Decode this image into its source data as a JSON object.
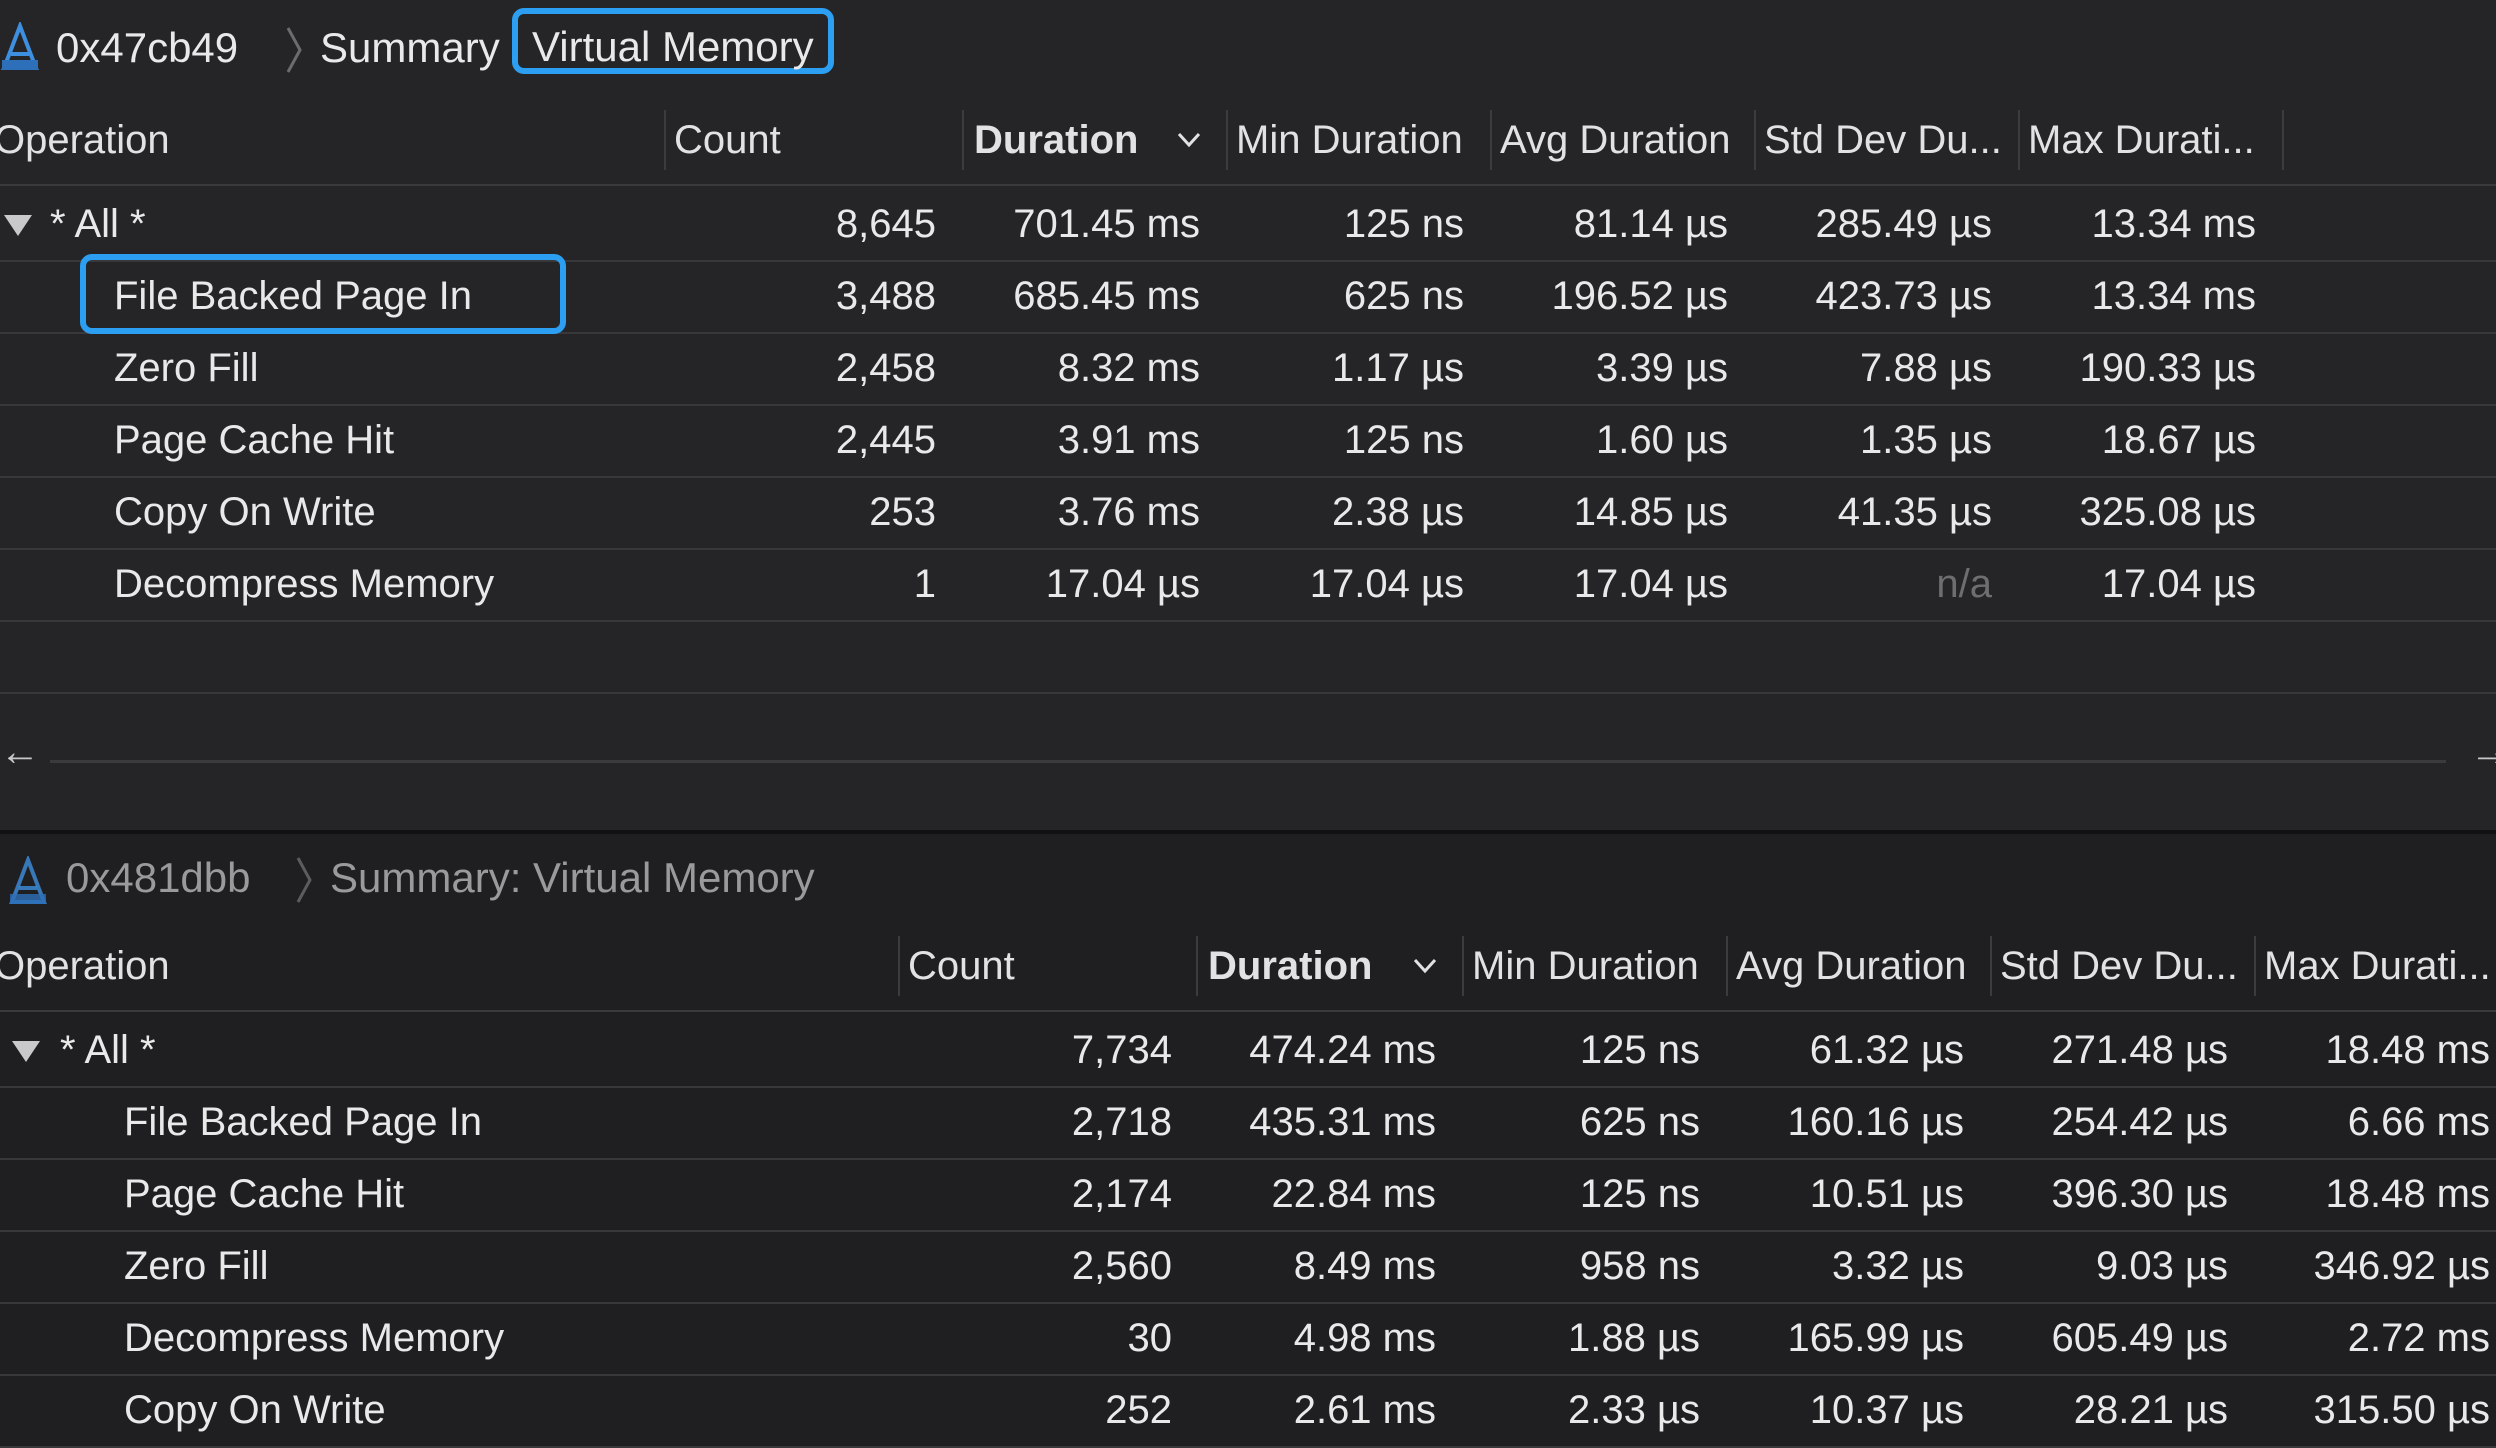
{
  "top": {
    "breadcrumb": {
      "process": "0x47cb49",
      "summary": "Summary",
      "selected": "Virtual Memory"
    },
    "headers": {
      "operation": "Operation",
      "count": "Count",
      "duration": "Duration",
      "min": "Min Duration",
      "avg": "Avg Duration",
      "std": "Std Dev Du...",
      "max": "Max Durati..."
    },
    "rows": [
      {
        "name": "* All *",
        "count": "8,645",
        "duration": "701.45 ms",
        "min": "125 ns",
        "avg": "81.14 µs",
        "std": "285.49 µs",
        "max": "13.34 ms"
      },
      {
        "name": "File Backed Page In",
        "count": "3,488",
        "duration": "685.45 ms",
        "min": "625 ns",
        "avg": "196.52 µs",
        "std": "423.73 µs",
        "max": "13.34 ms"
      },
      {
        "name": "Zero Fill",
        "count": "2,458",
        "duration": "8.32 ms",
        "min": "1.17 µs",
        "avg": "3.39 µs",
        "std": "7.88 µs",
        "max": "190.33 µs"
      },
      {
        "name": "Page Cache Hit",
        "count": "2,445",
        "duration": "3.91 ms",
        "min": "125 ns",
        "avg": "1.60 µs",
        "std": "1.35 µs",
        "max": "18.67 µs"
      },
      {
        "name": "Copy On Write",
        "count": "253",
        "duration": "3.76 ms",
        "min": "2.38 µs",
        "avg": "14.85 µs",
        "std": "41.35 µs",
        "max": "325.08 µs"
      },
      {
        "name": "Decompress Memory",
        "count": "1",
        "duration": "17.04 µs",
        "min": "17.04 µs",
        "avg": "17.04 µs",
        "std": "n/a",
        "max": "17.04 µs"
      }
    ]
  },
  "bottom": {
    "breadcrumb": {
      "process": "0x481dbb",
      "summary": "Summary: Virtual Memory"
    },
    "headers": {
      "operation": "Operation",
      "count": "Count",
      "duration": "Duration",
      "min": "Min Duration",
      "avg": "Avg Duration",
      "std": "Std Dev Du...",
      "max": "Max Durati..."
    },
    "rows": [
      {
        "name": "* All *",
        "count": "7,734",
        "duration": "474.24 ms",
        "min": "125 ns",
        "avg": "61.32 µs",
        "std": "271.48 µs",
        "max": "18.48 ms"
      },
      {
        "name": "File Backed Page In",
        "count": "2,718",
        "duration": "435.31 ms",
        "min": "625 ns",
        "avg": "160.16 µs",
        "std": "254.42 µs",
        "max": "6.66 ms"
      },
      {
        "name": "Page Cache Hit",
        "count": "2,174",
        "duration": "22.84 ms",
        "min": "125 ns",
        "avg": "10.51 µs",
        "std": "396.30 µs",
        "max": "18.48 ms"
      },
      {
        "name": "Zero Fill",
        "count": "2,560",
        "duration": "8.49 ms",
        "min": "958 ns",
        "avg": "3.32 µs",
        "std": "9.03 µs",
        "max": "346.92 µs"
      },
      {
        "name": "Decompress Memory",
        "count": "30",
        "duration": "4.98 ms",
        "min": "1.88 µs",
        "avg": "165.99 µs",
        "std": "605.49 µs",
        "max": "2.72 ms"
      },
      {
        "name": "Copy On Write",
        "count": "252",
        "duration": "2.61 ms",
        "min": "2.33 µs",
        "avg": "10.37 µs",
        "std": "28.21 µs",
        "max": "315.50 µs"
      }
    ]
  },
  "icons": {
    "app": "instruments-icon",
    "disclosure": "disclosure-triangle-icon",
    "sort": "chevron-down-icon",
    "breadcrumb_sep": "chevron-right-icon",
    "scroll_left": "arrow-left-icon",
    "scroll_right": "arrow-right-icon"
  },
  "colors": {
    "accent": "#2c9ff2",
    "background": "#252527",
    "text": "#e9e9ea",
    "muted": "#6e6e71"
  }
}
